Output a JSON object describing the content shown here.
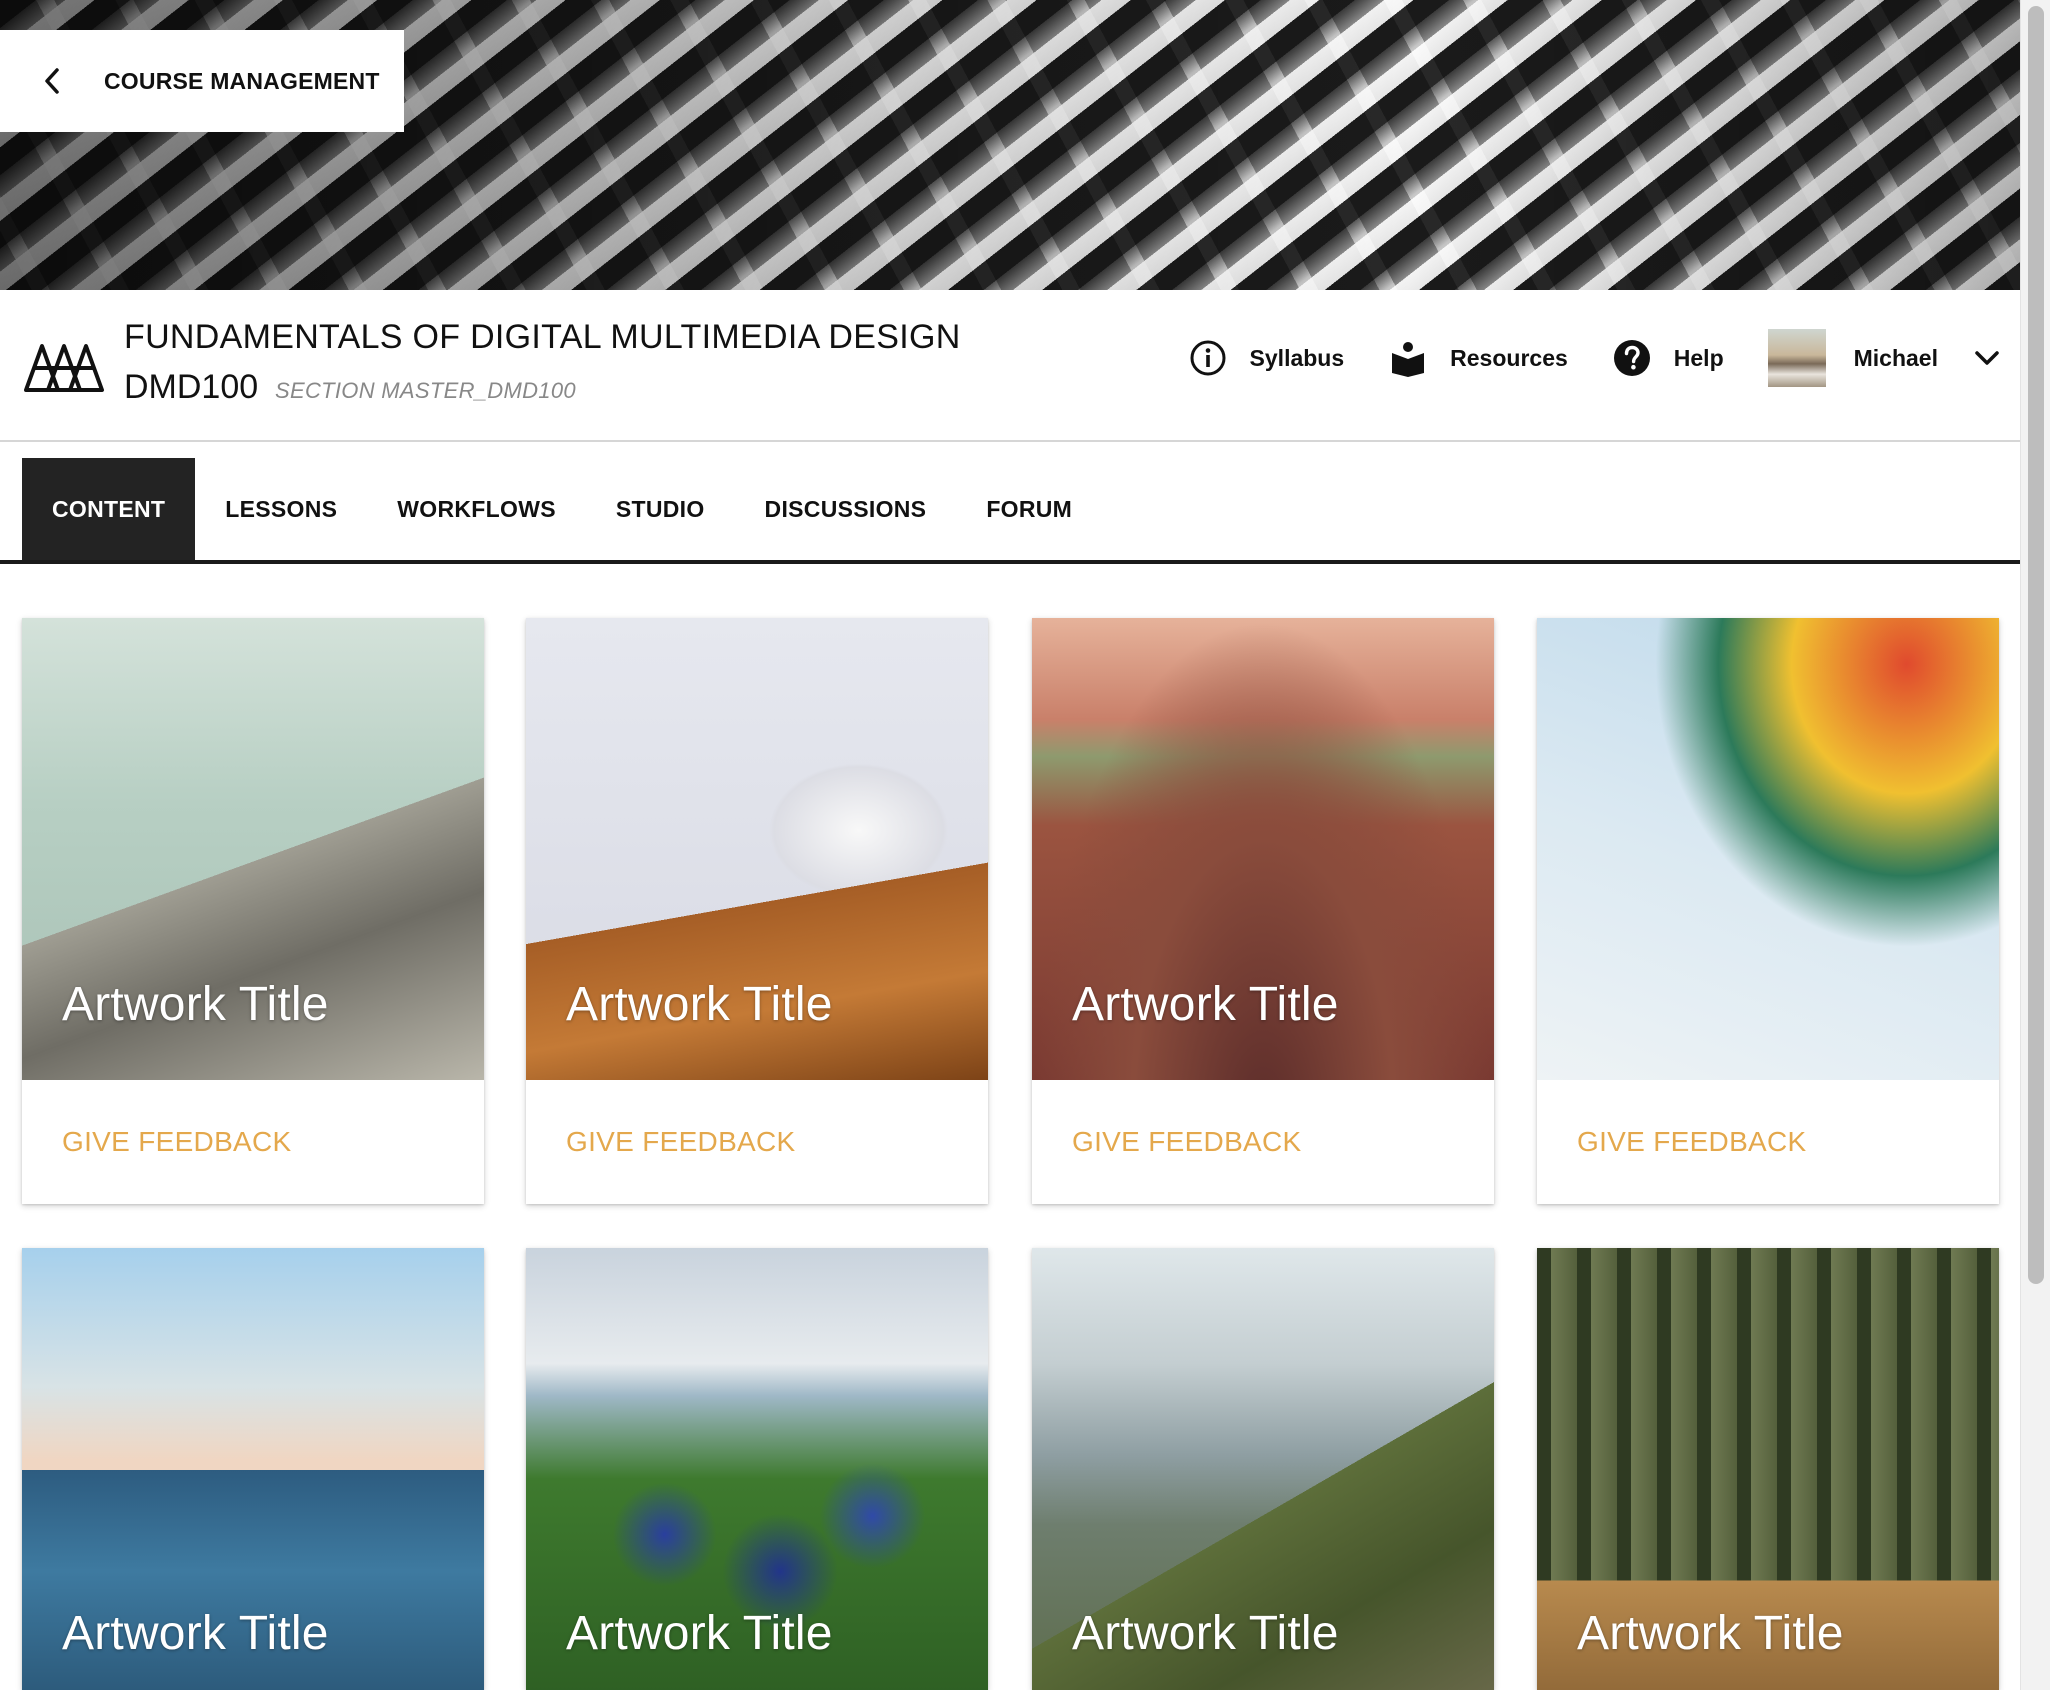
{
  "header": {
    "back_label": "COURSE MANAGEMENT"
  },
  "course": {
    "title": "FUNDAMENTALS OF DIGITAL MULTIMEDIA DESIGN",
    "code": "DMD100",
    "section": "SECTION MASTER_DMD100"
  },
  "nav": {
    "syllabus": "Syllabus",
    "resources": "Resources",
    "help": "Help",
    "user": "Michael"
  },
  "tabs": [
    {
      "label": "CONTENT",
      "active": true
    },
    {
      "label": "LESSONS",
      "active": false
    },
    {
      "label": "WORKFLOWS",
      "active": false
    },
    {
      "label": "STUDIO",
      "active": false
    },
    {
      "label": "DISCUSSIONS",
      "active": false
    },
    {
      "label": "FORUM",
      "active": false
    }
  ],
  "cards": [
    {
      "title": "Artwork Title",
      "action": "GIVE FEEDBACK"
    },
    {
      "title": "Artwork Title",
      "action": "GIVE FEEDBACK"
    },
    {
      "title": "Artwork Title",
      "action": "GIVE FEEDBACK"
    },
    {
      "title": "Artwork Title",
      "action": "GIVE FEEDBACK"
    },
    {
      "title": "Artwork Title"
    },
    {
      "title": "Artwork Title"
    },
    {
      "title": "Artwork Title"
    },
    {
      "title": "Artwork Title"
    }
  ],
  "colors": {
    "accent": "#e4a84c",
    "active_tab": "#232323"
  }
}
